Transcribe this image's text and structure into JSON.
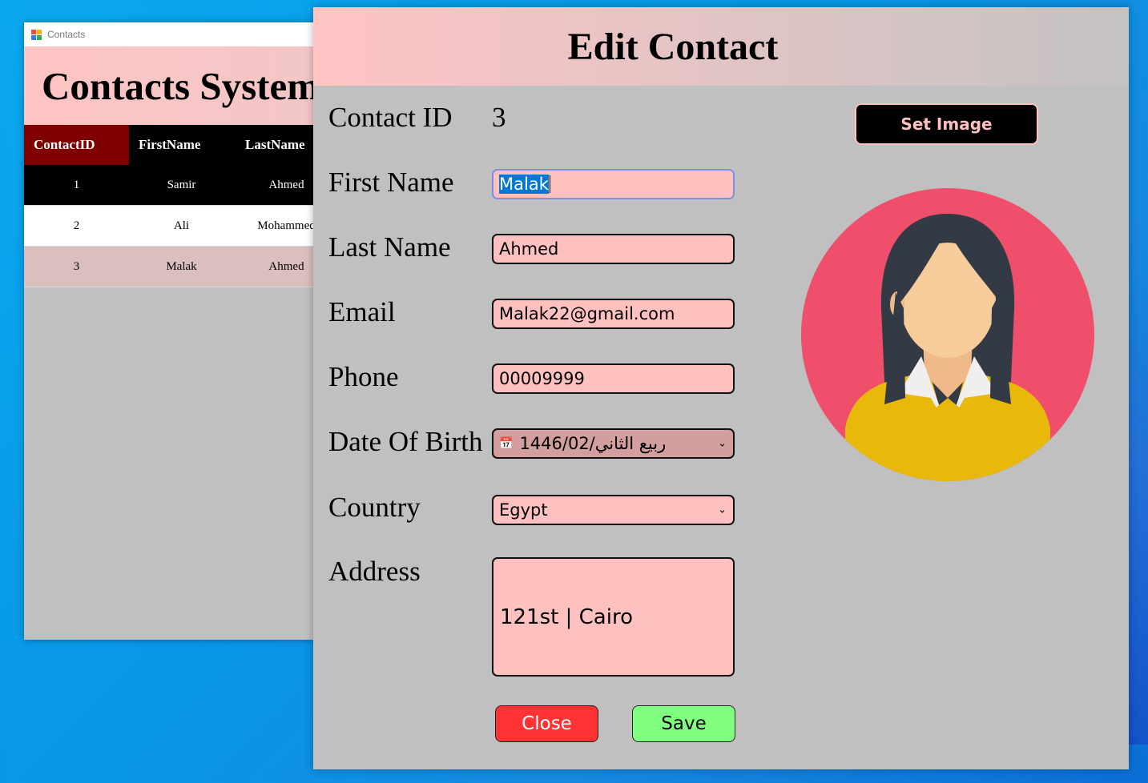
{
  "colors": {
    "desktop": "#0aa8ee",
    "header_pink": "#ffc4c4",
    "field_bg": "#ffc0c0",
    "close_button": "#ff3333",
    "save_button": "#80ff80",
    "grid_header_first": "#800000",
    "selected_row": "#dbbebe",
    "avatar_bg": "#ef4f6b",
    "avatar_shirt": "#e8b80a"
  },
  "background_window": {
    "title": "Contacts",
    "header": "Contacts System",
    "grid": {
      "columns": [
        "ContactID",
        "FirstName",
        "LastName"
      ],
      "rows": [
        [
          "1",
          "Samir",
          "Ahmed"
        ],
        [
          "2",
          "Ali",
          "Mohammed"
        ],
        [
          "3",
          "Malak",
          "Ahmed"
        ]
      ]
    }
  },
  "dialog": {
    "title": "Edit Contact",
    "labels": {
      "contact_id": "Contact ID",
      "first_name": "First Name",
      "last_name": "Last Name",
      "email": "Email",
      "phone": "Phone",
      "dob": "Date Of Birth",
      "country": "Country",
      "address": "Address"
    },
    "contact_id": "3",
    "first_name": "Malak",
    "last_name": "Ahmed",
    "email": "Malak22@gmail.com",
    "phone": "00009999",
    "dob": "1446/02/ربيع الثاني",
    "country": "Egypt",
    "address": "121st | Cairo",
    "buttons": {
      "set_image": "Set Image",
      "close": "Close",
      "save": "Save"
    },
    "icons": {
      "calendar": "calendar-icon",
      "dropdown": "chevron-down-icon"
    }
  }
}
